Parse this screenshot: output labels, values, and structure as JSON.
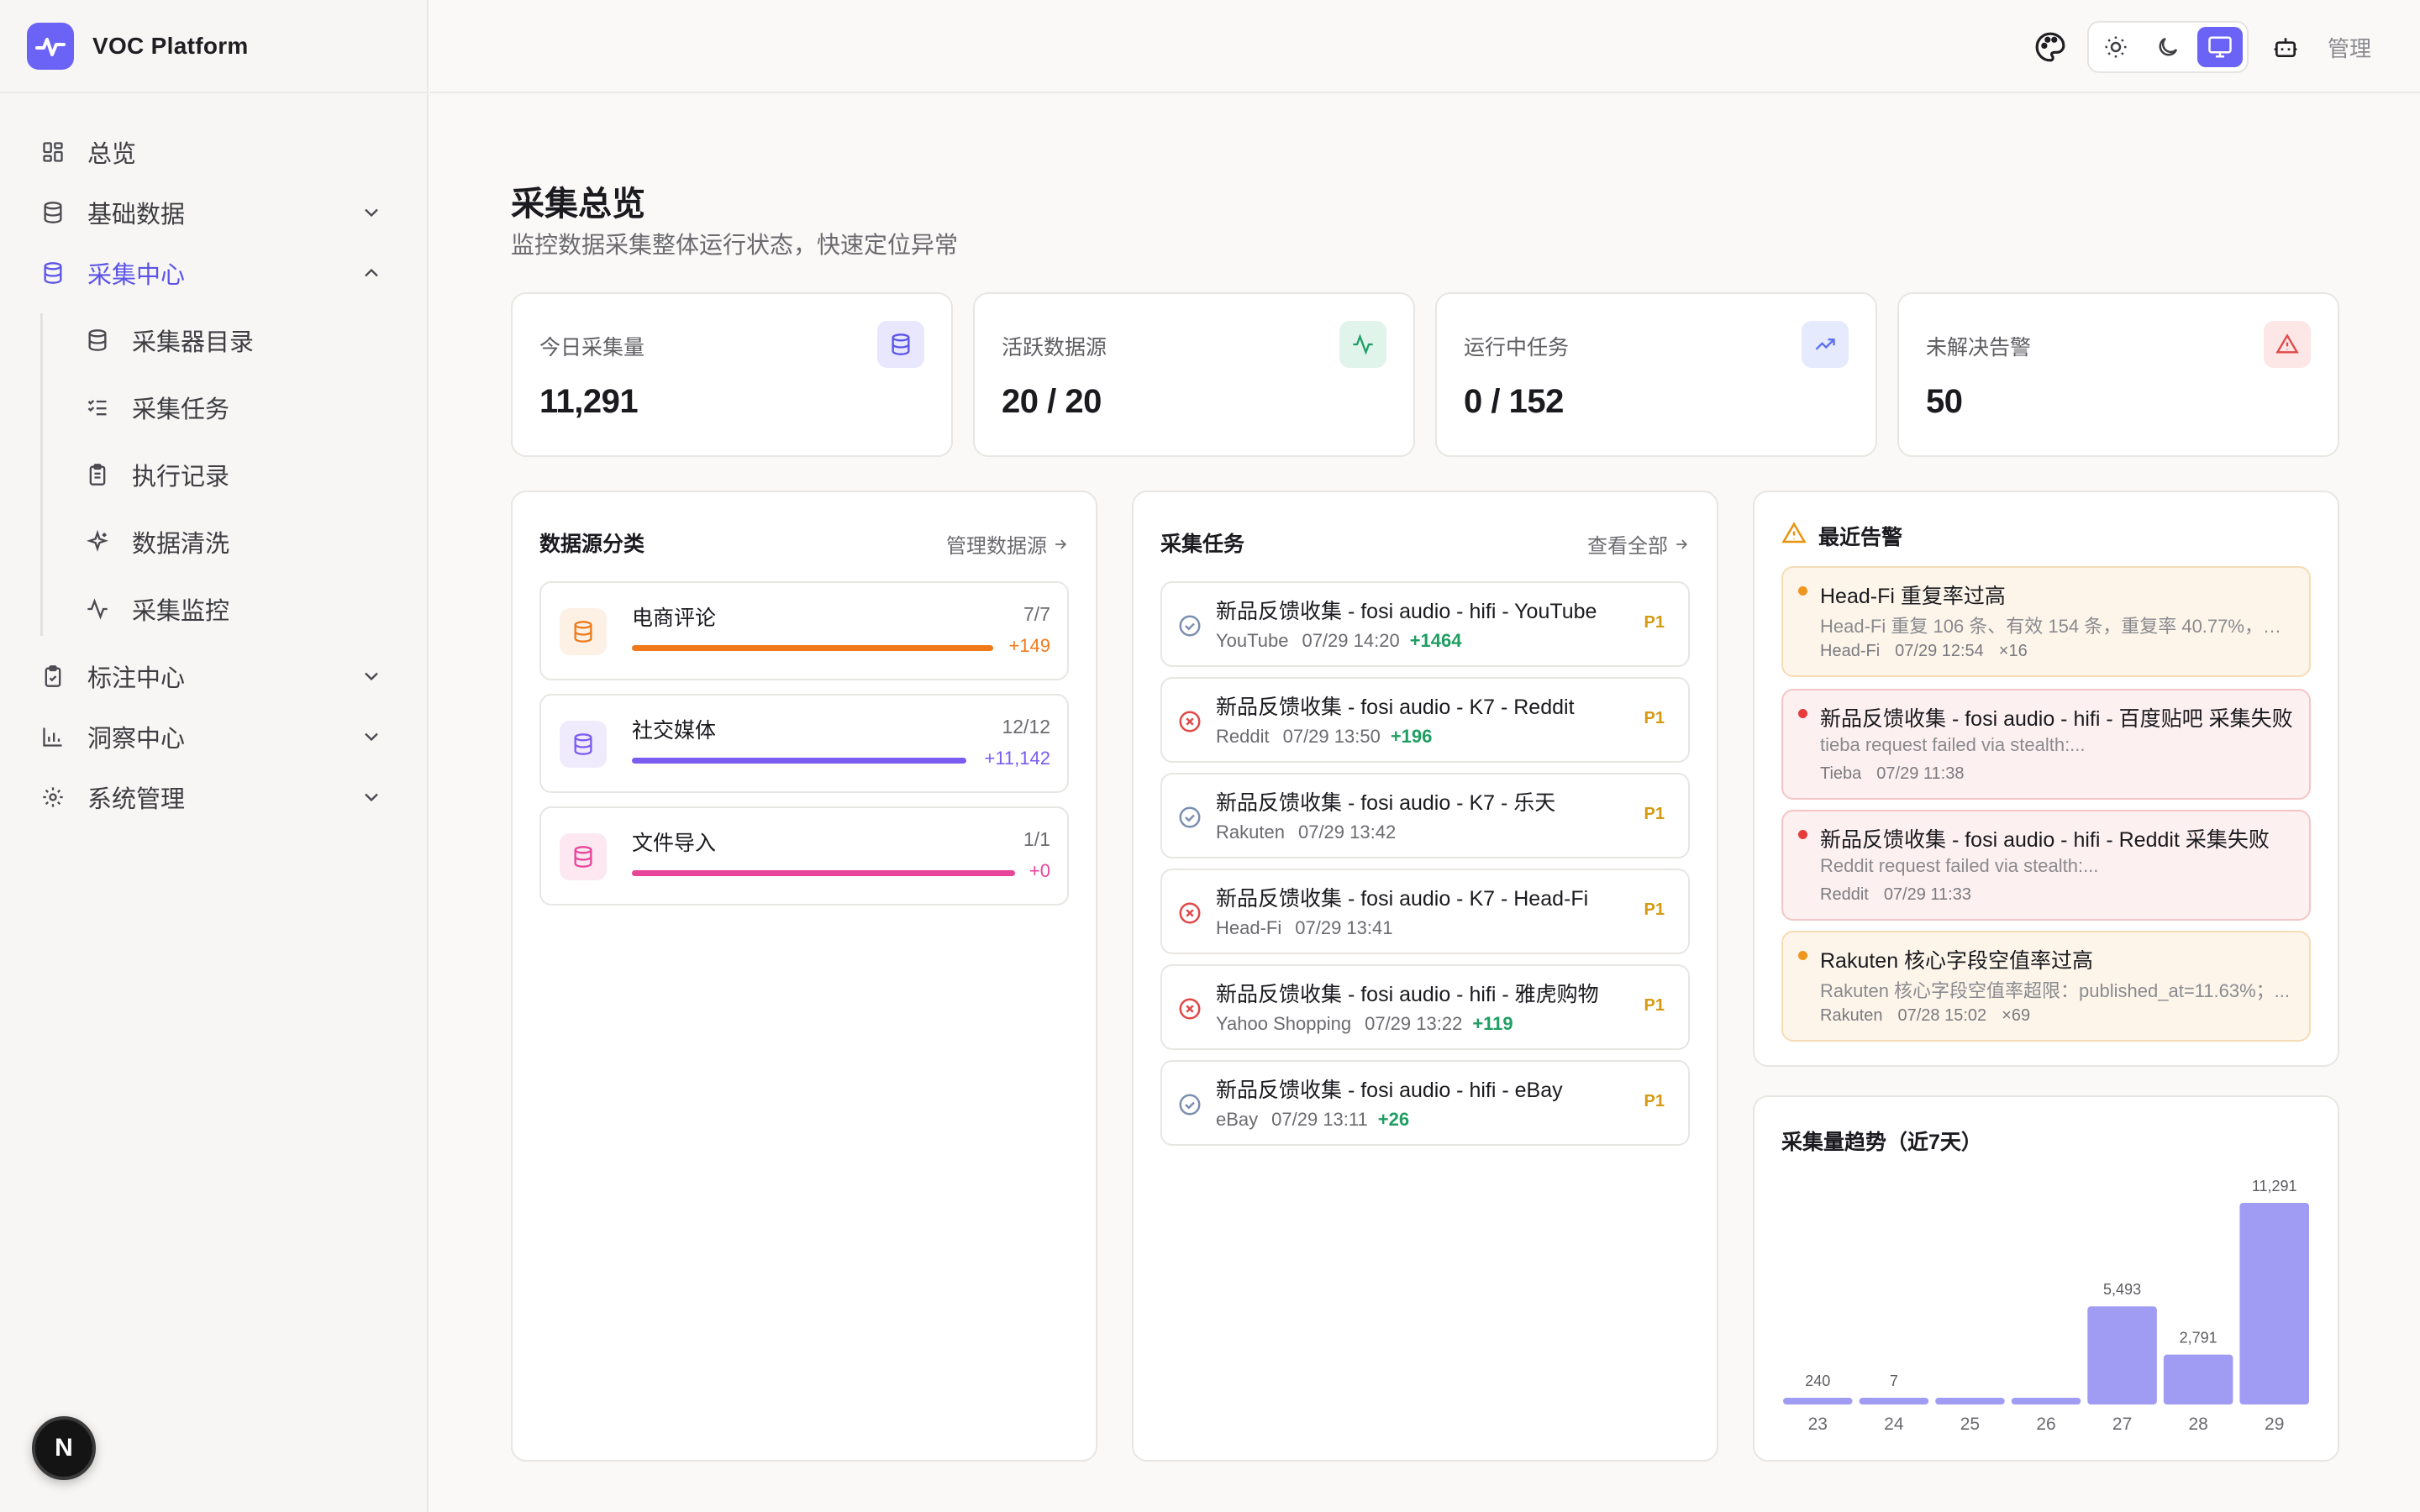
{
  "brand": {
    "name": "VOC Platform"
  },
  "sidebar": {
    "items": [
      {
        "label": "总览"
      },
      {
        "label": "基础数据"
      },
      {
        "label": "采集中心"
      },
      {
        "label": "标注中心"
      },
      {
        "label": "洞察中心"
      },
      {
        "label": "系统管理"
      }
    ],
    "sub_items": [
      {
        "label": "采集器目录"
      },
      {
        "label": "采集任务"
      },
      {
        "label": "执行记录"
      },
      {
        "label": "数据清洗"
      },
      {
        "label": "采集监控"
      }
    ],
    "fab_label": "N"
  },
  "header": {
    "admin_label": "管理"
  },
  "page": {
    "title": "采集总览",
    "subtitle": "监控数据采集整体运行状态，快速定位异常"
  },
  "stats": [
    {
      "label": "今日采集量",
      "value": "11,291"
    },
    {
      "label": "活跃数据源",
      "value": "20 / 20"
    },
    {
      "label": "运行中任务",
      "value": "0 / 152"
    },
    {
      "label": "未解决告警",
      "value": "50"
    }
  ],
  "sources": {
    "title": "数据源分类",
    "link": "管理数据源",
    "items": [
      {
        "name": "电商评论",
        "count": "7/7",
        "delta": "+149",
        "color": "#f07a1a"
      },
      {
        "name": "社交媒体",
        "count": "12/12",
        "delta": "+11,142",
        "color": "#7a5cf0"
      },
      {
        "name": "文件导入",
        "count": "1/1",
        "delta": "+0",
        "color": "#e8449a"
      }
    ]
  },
  "tasks": {
    "title": "采集任务",
    "link": "查看全部",
    "items": [
      {
        "name": "新品反馈收集 - fosi audio - hifi - YouTube",
        "source": "YouTube",
        "time": "07/29 14:20",
        "plus": "+1464",
        "priority": "P1",
        "status": "ok"
      },
      {
        "name": "新品反馈收集 - fosi audio - K7 - Reddit",
        "source": "Reddit",
        "time": "07/29 13:50",
        "plus": "+196",
        "priority": "P1",
        "status": "fail"
      },
      {
        "name": "新品反馈收集 - fosi audio - K7 - 乐天",
        "source": "Rakuten",
        "time": "07/29 13:42",
        "plus": "",
        "priority": "P1",
        "status": "ok"
      },
      {
        "name": "新品反馈收集 - fosi audio - K7 - Head-Fi",
        "source": "Head-Fi",
        "time": "07/29 13:41",
        "plus": "",
        "priority": "P1",
        "status": "fail"
      },
      {
        "name": "新品反馈收集 - fosi audio - hifi - 雅虎购物",
        "source": "Yahoo Shopping",
        "time": "07/29 13:22",
        "plus": "+119",
        "priority": "P1",
        "status": "fail"
      },
      {
        "name": "新品反馈收集 - fosi audio - hifi - eBay",
        "source": "eBay",
        "time": "07/29 13:11",
        "plus": "+26",
        "priority": "P1",
        "status": "ok"
      }
    ]
  },
  "alerts": {
    "title": "最近告警",
    "items": [
      {
        "title": "Head-Fi 重复率过高",
        "desc": "Head-Fi 重复 106 条、有效 154 条，重复率 40.77%，高...",
        "source": "Head-Fi",
        "time": "07/29 12:54",
        "count": "×16",
        "level": "warn"
      },
      {
        "title": "新品反馈收集 - fosi audio - hifi - 百度贴吧 采集失败",
        "desc": "tieba request failed via stealth:...",
        "source": "Tieba",
        "time": "07/29 11:38",
        "count": "",
        "level": "error"
      },
      {
        "title": "新品反馈收集 - fosi audio - hifi - Reddit 采集失败",
        "desc": "Reddit request failed via stealth:...",
        "source": "Reddit",
        "time": "07/29 11:33",
        "count": "",
        "level": "error"
      },
      {
        "title": "Rakuten 核心字段空值率过高",
        "desc": "Rakuten 核心字段空值率超限：published_at=11.63%；...",
        "source": "Rakuten",
        "time": "07/28 15:02",
        "count": "×69",
        "level": "warn"
      }
    ]
  },
  "chart_data": {
    "type": "bar",
    "title": "采集量趋势（近7天）",
    "categories": [
      "23",
      "24",
      "25",
      "26",
      "27",
      "28",
      "29"
    ],
    "values": [
      240,
      7,
      0,
      0,
      5493,
      2791,
      11291
    ],
    "value_labels": [
      "240",
      "7",
      "",
      "",
      "5,493",
      "2,791",
      "11,291"
    ],
    "ylim": [
      0,
      11291
    ],
    "color": "#a09cf3"
  }
}
